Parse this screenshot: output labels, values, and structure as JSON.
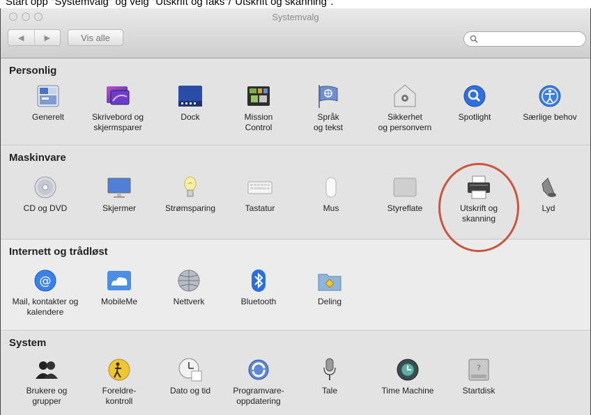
{
  "caption": "Start opp \"Systemvalg\" og velg \"Utskrift og faks\"/\"Utskrift og skanning\".",
  "window": {
    "title": "Systemvalg",
    "back_label": "◀",
    "forward_label": "▶",
    "show_all_label": "Vis alle",
    "search_placeholder": ""
  },
  "sections": {
    "personal": {
      "title": "Personlig",
      "items": [
        {
          "label": "Generelt",
          "icon": "general-icon"
        },
        {
          "label": "Skrivebord og\nskjermsparer",
          "icon": "desktop-screensaver-icon"
        },
        {
          "label": "Dock",
          "icon": "dock-icon"
        },
        {
          "label": "Mission\nControl",
          "icon": "mission-control-icon"
        },
        {
          "label": "Språk\nog tekst",
          "icon": "language-text-icon"
        },
        {
          "label": "Sikkerhet\nog personvern",
          "icon": "security-icon"
        },
        {
          "label": "Spotlight",
          "icon": "spotlight-icon"
        },
        {
          "label": "Særlige behov",
          "icon": "accessibility-icon"
        }
      ]
    },
    "hardware": {
      "title": "Maskinvare",
      "items": [
        {
          "label": "CD og DVD",
          "icon": "cd-dvd-icon"
        },
        {
          "label": "Skjermer",
          "icon": "displays-icon"
        },
        {
          "label": "Strømsparing",
          "icon": "energy-saver-icon"
        },
        {
          "label": "Tastatur",
          "icon": "keyboard-icon"
        },
        {
          "label": "Mus",
          "icon": "mouse-icon"
        },
        {
          "label": "Styreflate",
          "icon": "trackpad-icon"
        },
        {
          "label": "Utskrift og\nskanning",
          "icon": "printer-icon"
        },
        {
          "label": "Lyd",
          "icon": "sound-icon"
        }
      ]
    },
    "internet": {
      "title": "Internett og trådløst",
      "items": [
        {
          "label": "Mail, kontakter og\nkalendere",
          "icon": "mail-contacts-icon"
        },
        {
          "label": "MobileMe",
          "icon": "mobileme-icon"
        },
        {
          "label": "Nettverk",
          "icon": "network-icon"
        },
        {
          "label": "Bluetooth",
          "icon": "bluetooth-icon"
        },
        {
          "label": "Deling",
          "icon": "sharing-icon"
        }
      ]
    },
    "system": {
      "title": "System",
      "items": [
        {
          "label": "Brukere og\ngrupper",
          "icon": "users-groups-icon"
        },
        {
          "label": "Foreldre-\nkontroll",
          "icon": "parental-controls-icon"
        },
        {
          "label": "Dato og tid",
          "icon": "date-time-icon"
        },
        {
          "label": "Programvare-\noppdatering",
          "icon": "software-update-icon"
        },
        {
          "label": "Tale",
          "icon": "speech-icon"
        },
        {
          "label": "Time Machine",
          "icon": "time-machine-icon"
        },
        {
          "label": "Startdisk",
          "icon": "startup-disk-icon"
        }
      ]
    }
  }
}
